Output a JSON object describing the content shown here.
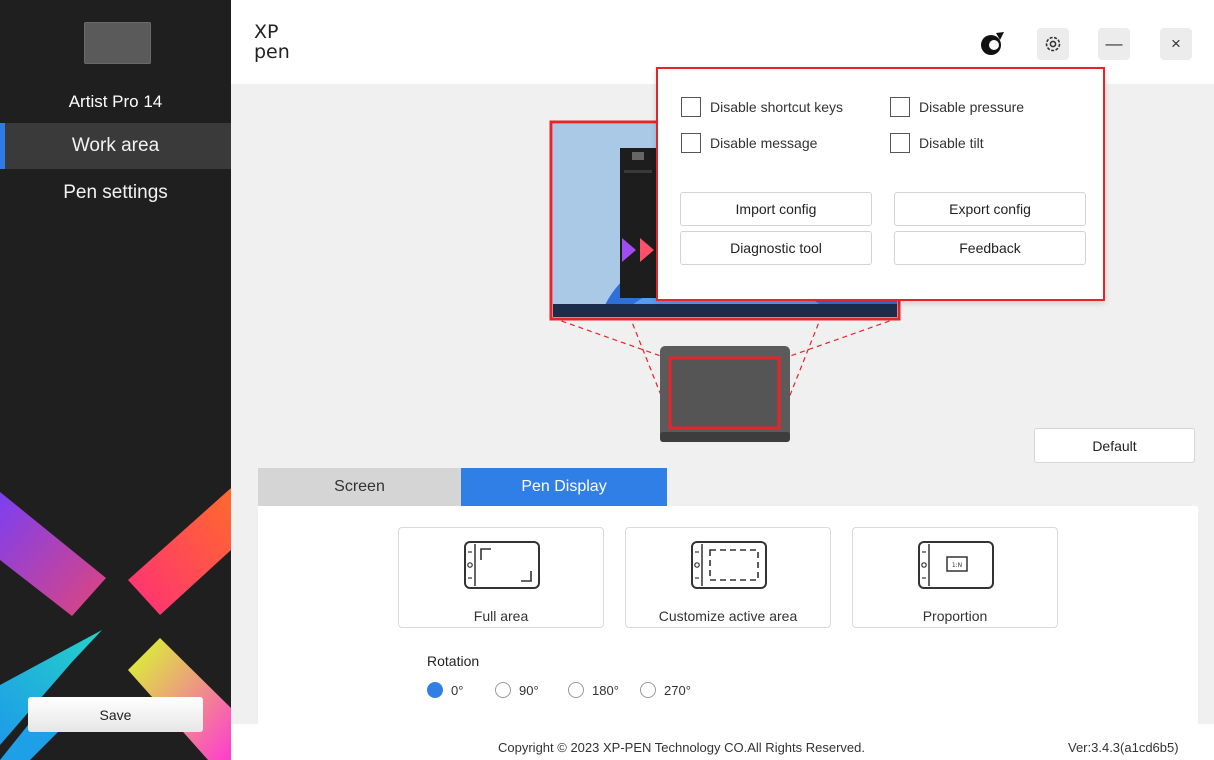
{
  "app": {
    "logo_text_top": "XP",
    "logo_text_bottom": "pen"
  },
  "sidebar": {
    "device_name": "Artist Pro 14",
    "items": [
      {
        "label": "Work area",
        "active": true
      },
      {
        "label": "Pen settings",
        "active": false
      }
    ],
    "save_label": "Save"
  },
  "header": {
    "icons": [
      "xp-pen-community-icon",
      "gear-icon",
      "minimize-icon",
      "close-icon"
    ],
    "minimize_glyph": "—",
    "close_glyph": "×"
  },
  "popup": {
    "checkboxes": [
      {
        "label": "Disable shortcut keys",
        "checked": false
      },
      {
        "label": "Disable pressure",
        "checked": false
      },
      {
        "label": "Disable message",
        "checked": false
      },
      {
        "label": "Disable tilt",
        "checked": false
      }
    ],
    "buttons": {
      "import": "Import config",
      "export": "Export config",
      "diagnostic": "Diagnostic tool",
      "feedback": "Feedback"
    }
  },
  "work_area": {
    "default_label": "Default",
    "tabs": [
      {
        "label": "Screen",
        "active": false
      },
      {
        "label": "Pen Display",
        "active": true
      }
    ],
    "modes": [
      {
        "label": "Full area"
      },
      {
        "label": "Customize active area"
      },
      {
        "label": "Proportion",
        "icon_text": "1:N"
      }
    ],
    "rotation": {
      "label": "Rotation",
      "options": [
        "0°",
        "90°",
        "180°",
        "270°"
      ],
      "selected": "0°"
    }
  },
  "footer": {
    "copyright": "Copyright © 2023  XP-PEN Technology CO.All Rights Reserved.",
    "version": "Ver:3.4.3(a1cd6b5)"
  },
  "colors": {
    "accent": "#2f7fe6",
    "highlight": "#e5252a",
    "sidebar": "#1f1f1f"
  }
}
